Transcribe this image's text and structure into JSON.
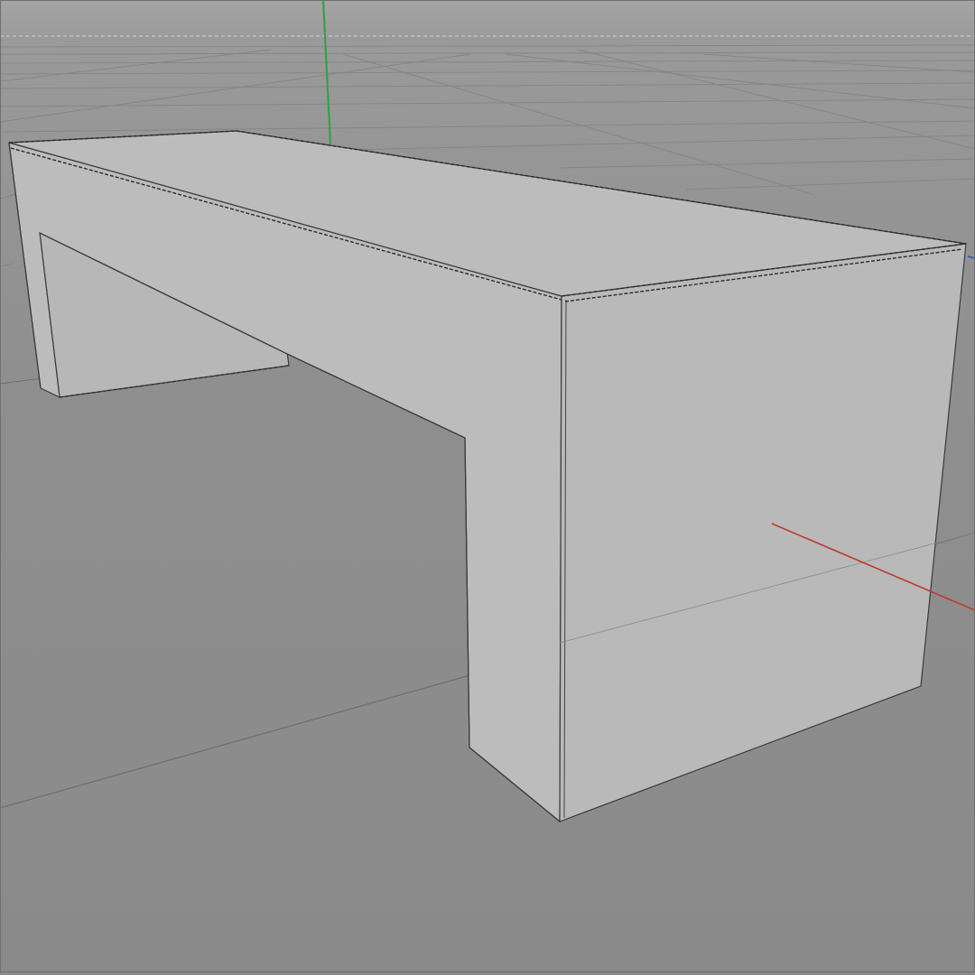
{
  "viewport": {
    "view": "perspective",
    "shading": "gouraud-with-lines",
    "background_color": "#8c8c8c",
    "sky_color": "#a3a3a3",
    "horizon_color": "#9a9a9a",
    "floor_grid_color": "#7e7e7e",
    "grid_visible": true
  },
  "axes": {
    "x_axis_color": "#c0392b",
    "y_axis_color": "#2ea043",
    "z_axis_color": "#2f4bd6"
  },
  "object": {
    "name_icon": "bench-model-icon",
    "face_color": "#bcbcbc",
    "face_color_side": "#b9b9b9",
    "edge_color": "#3a3a3a",
    "selected_edge_style": "dashed"
  }
}
